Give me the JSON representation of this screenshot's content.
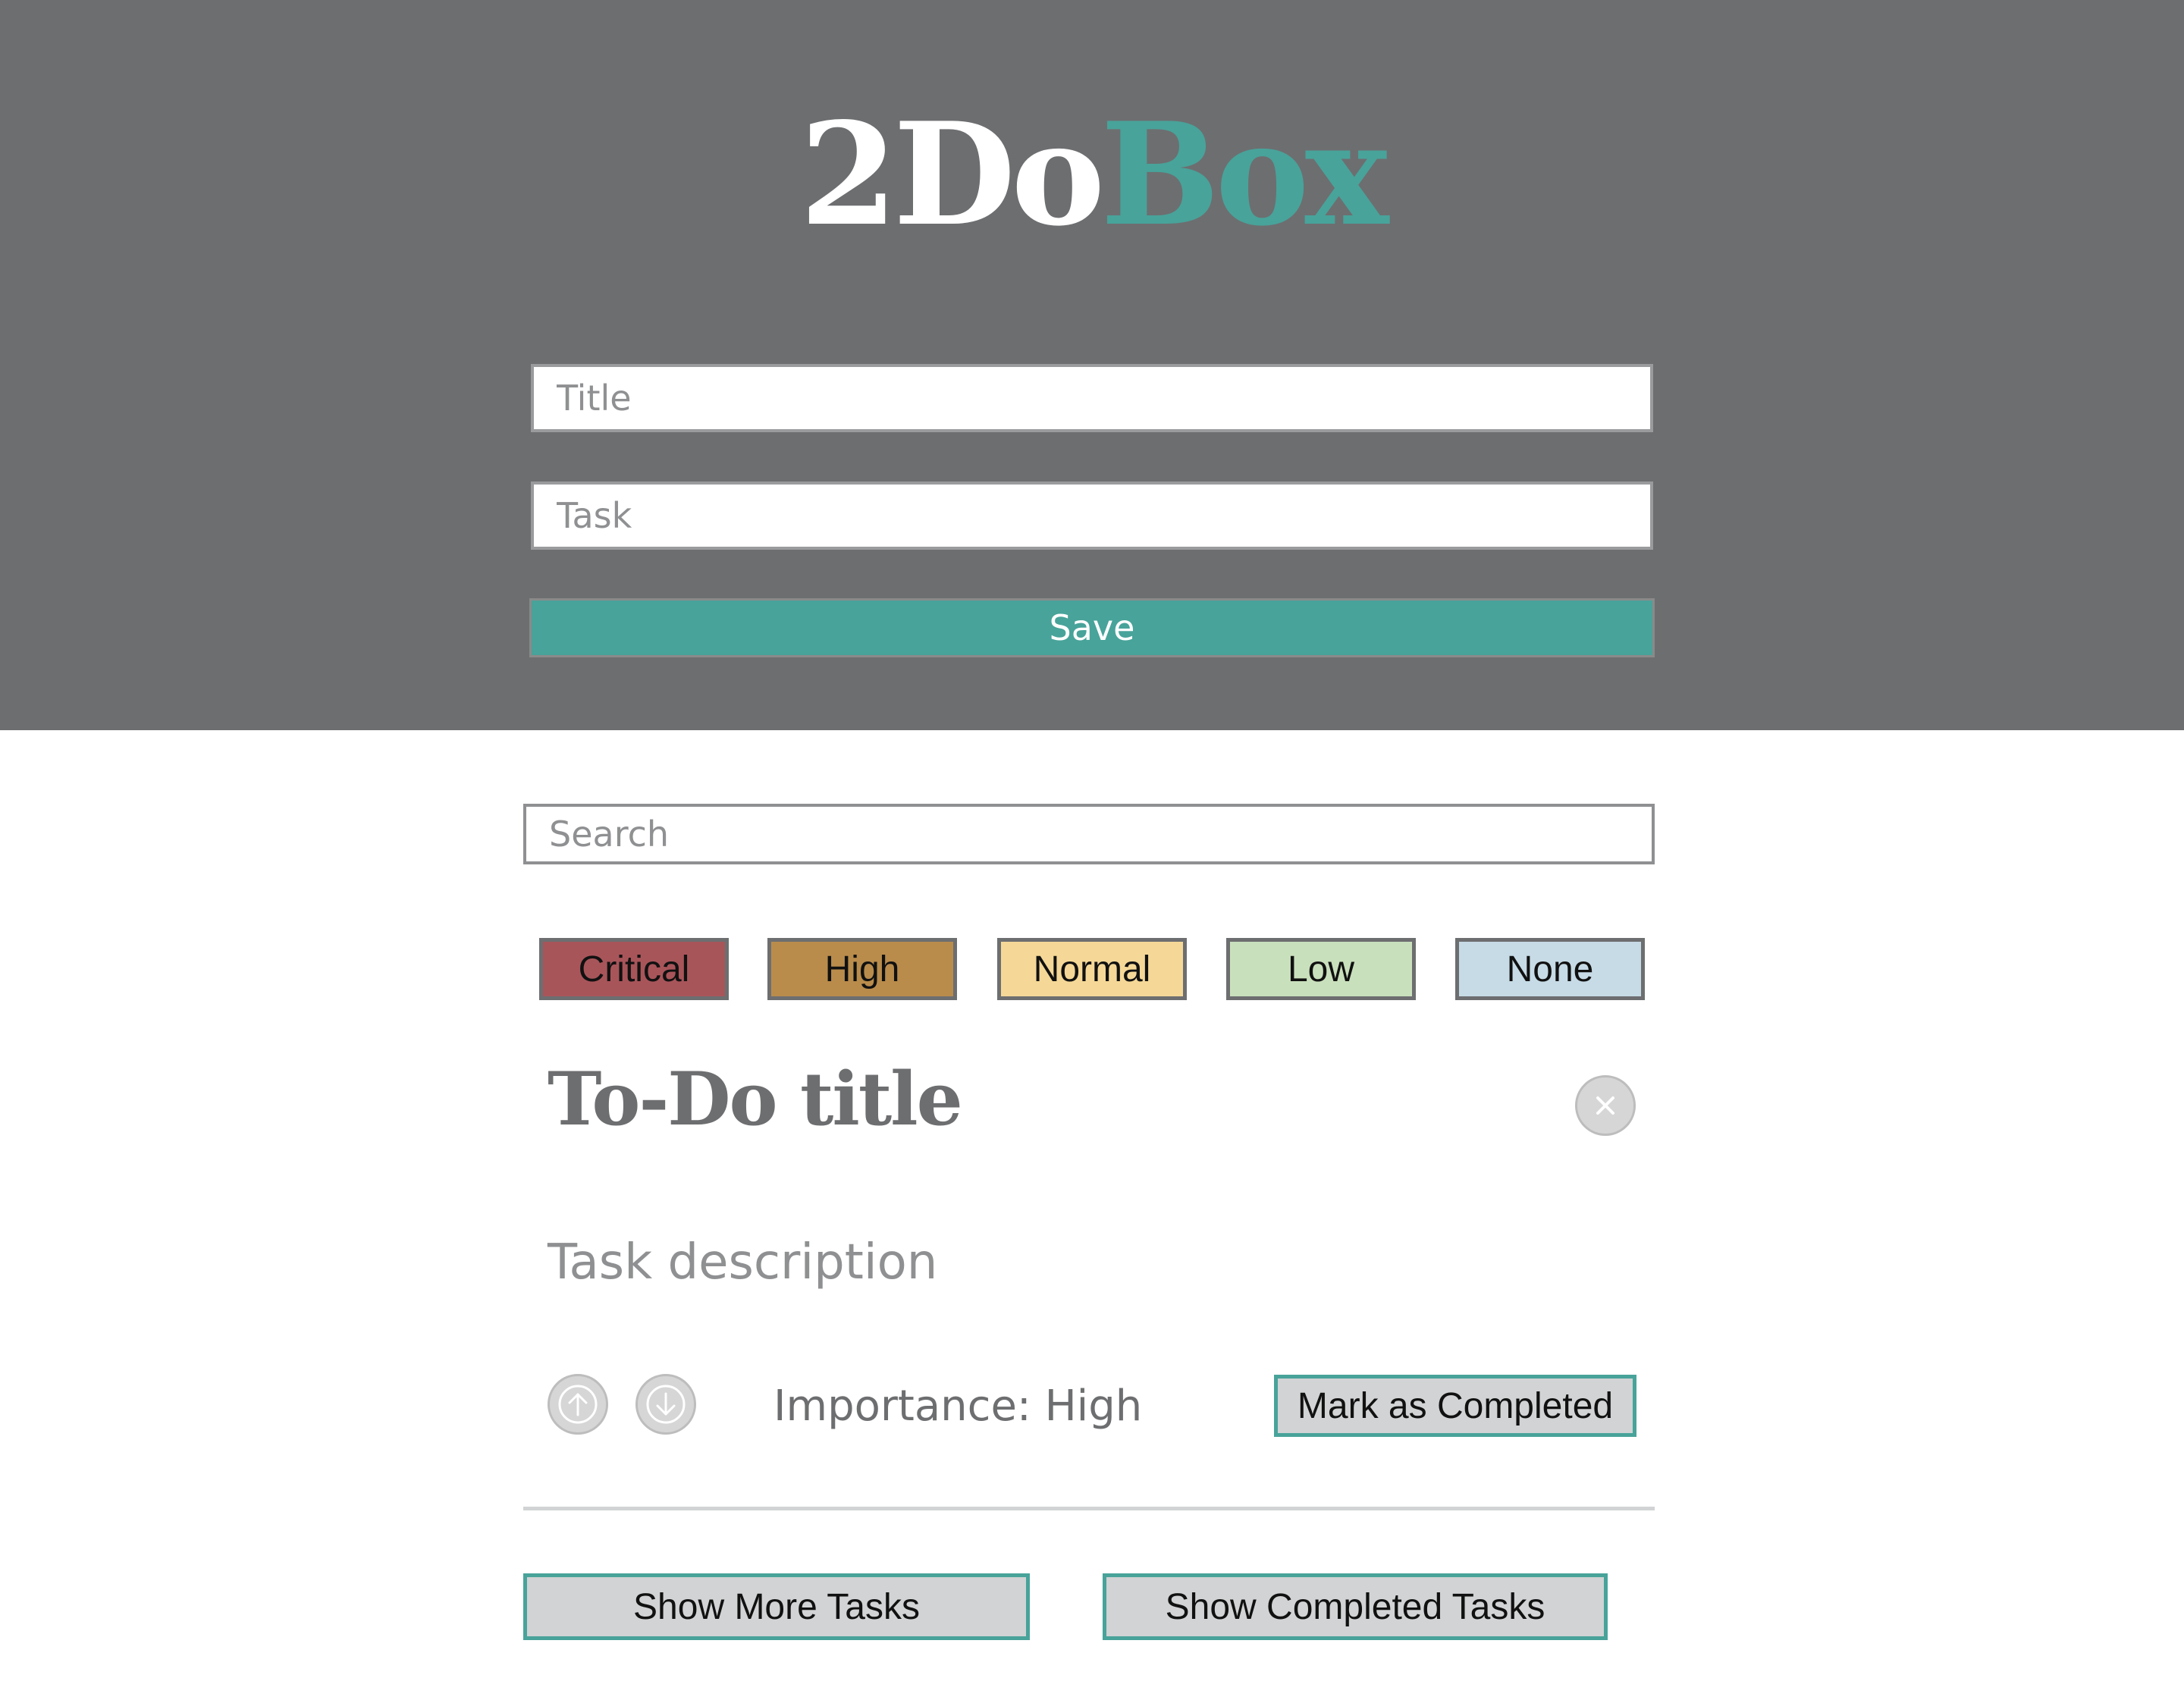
{
  "app": {
    "logo_part1": "2Do",
    "logo_part2": "Box"
  },
  "form": {
    "title_placeholder": "Title",
    "task_placeholder": "Task",
    "title_value": "",
    "task_value": "",
    "save_label": "Save"
  },
  "search": {
    "placeholder": "Search",
    "value": ""
  },
  "filters": [
    {
      "label": "Critical",
      "color": "#a8555a"
    },
    {
      "label": "High",
      "color": "#b98c4c"
    },
    {
      "label": "Normal",
      "color": "#f5d897"
    },
    {
      "label": "Low",
      "color": "#c9e0bc"
    },
    {
      "label": "None",
      "color": "#c6dbe6"
    }
  ],
  "card": {
    "title": "To-Do title",
    "description": "Task description",
    "importance": "Importance: High",
    "complete_label": "Mark as Completed",
    "delete_icon": "close-icon",
    "upvote_icon": "arrow-up-icon",
    "downvote_icon": "arrow-down-icon"
  },
  "footer": {
    "show_more_label": "Show More Tasks",
    "show_completed_label": "Show Completed Tasks"
  },
  "colors": {
    "header_bg": "#6d6e70",
    "accent": "#48a39a",
    "button_gray": "#d1d3d4"
  }
}
